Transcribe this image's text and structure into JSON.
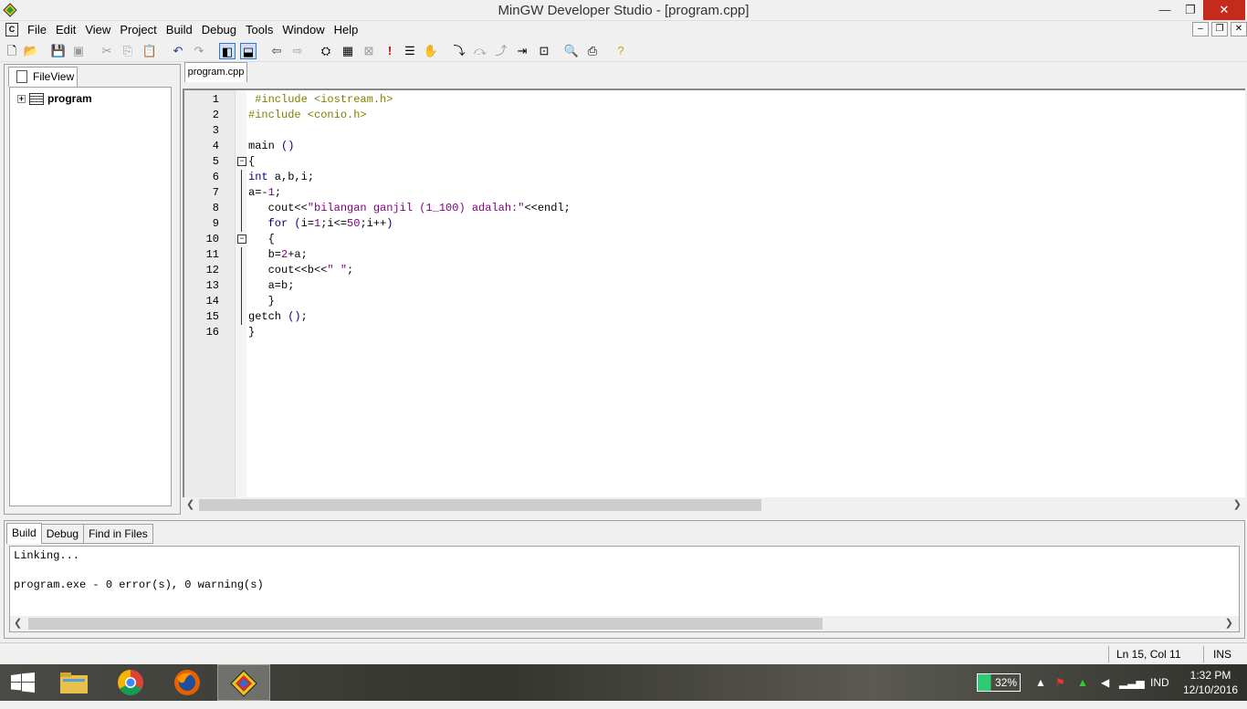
{
  "window": {
    "title": "MinGW Developer Studio - [program.cpp]",
    "minimize": "—",
    "restore": "❐",
    "close": "✕"
  },
  "menu": {
    "icon_label": "C",
    "items": [
      "File",
      "Edit",
      "View",
      "Project",
      "Build",
      "Debug",
      "Tools",
      "Window",
      "Help"
    ]
  },
  "mdi_controls": {
    "minimize": "–",
    "restore": "❐",
    "close": "✕"
  },
  "toolbar": {
    "icons": [
      "new-file-icon",
      "open-folder-icon",
      "save-icon",
      "save-all-icon",
      "cut-icon",
      "copy-icon",
      "paste-icon",
      "undo-icon",
      "redo-icon",
      "workspace-toggle-icon",
      "output-toggle-icon",
      "back-icon",
      "forward-icon",
      "compile-icon",
      "build-icon",
      "stop-build-icon",
      "execute-icon",
      "toggle-breakpoint-icon",
      "hand-icon",
      "step-into-icon",
      "step-over-icon",
      "step-out-icon",
      "run-to-cursor-icon",
      "quick-watch-icon",
      "find-icon",
      "print-icon",
      "help-icon"
    ]
  },
  "left_pane": {
    "tab_label": "FileView",
    "tree": {
      "expander": "+",
      "root_label": "program"
    }
  },
  "editor": {
    "tab_label": "program.cpp",
    "lines": [
      {
        "num": "1",
        "text": " #include <iostream.h>"
      },
      {
        "num": "2",
        "text": "#include <conio.h>"
      },
      {
        "num": "3",
        "text": ""
      },
      {
        "num": "4",
        "text": "main ()"
      },
      {
        "num": "5",
        "text": "{"
      },
      {
        "num": "6",
        "text": "int a,b,i;"
      },
      {
        "num": "7",
        "text": "a=-1;"
      },
      {
        "num": "8",
        "text": "   cout<<\"bilangan ganjil (1_100) adalah:\"<<endl;"
      },
      {
        "num": "9",
        "text": "   for (i=1;i<=50;i++)"
      },
      {
        "num": "10",
        "text": "   {"
      },
      {
        "num": "11",
        "text": "   b=2+a;"
      },
      {
        "num": "12",
        "text": "   cout<<b<<\" \";"
      },
      {
        "num": "13",
        "text": "   a=b;"
      },
      {
        "num": "14",
        "text": "   }"
      },
      {
        "num": "15",
        "text": "getch ();"
      },
      {
        "num": "16",
        "text": "}"
      }
    ],
    "fold_marker": "−"
  },
  "bottom_pane": {
    "tabs": [
      "Build",
      "Debug",
      "Find in Files"
    ],
    "output_lines": [
      "Linking...",
      "",
      "program.exe - 0 error(s), 0 warning(s)"
    ]
  },
  "status": {
    "position": "Ln 15, Col 11",
    "mode": "INS"
  },
  "taskbar": {
    "battery": "32%",
    "language": "IND",
    "time": "1:32 PM",
    "date": "12/10/2016"
  },
  "colors": {
    "preprocessor": "#808000",
    "keyword": "#000080",
    "string": "#800080",
    "number": "#800080",
    "accent": "#3375d6"
  }
}
